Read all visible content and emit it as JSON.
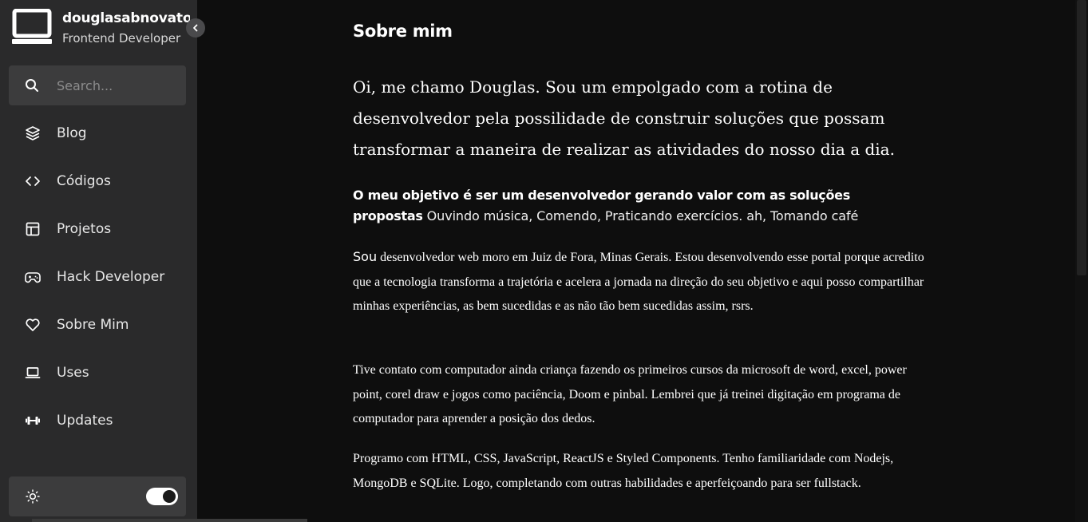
{
  "profile": {
    "name": "douglasabnovato",
    "role": "Frontend Developer",
    "icon": "laptop-icon"
  },
  "search": {
    "placeholder": "Search..."
  },
  "nav": {
    "items": [
      {
        "label": "Blog",
        "icon": "layers-icon"
      },
      {
        "label": "Códigos",
        "icon": "code-icon"
      },
      {
        "label": "Projetos",
        "icon": "layout-icon"
      },
      {
        "label": "Hack Developer",
        "icon": "gamepad-icon"
      },
      {
        "label": "Sobre Mim",
        "icon": "heart-icon"
      },
      {
        "label": "Uses",
        "icon": "laptop-icon"
      },
      {
        "label": "Updates",
        "icon": "dumbbell-icon"
      }
    ]
  },
  "theme": {
    "icon": "sun-icon",
    "dark_mode_enabled": true
  },
  "article": {
    "title": "Sobre mim",
    "intro": "Oi, me chamo Douglas. Sou um empolgado com a rotina de desenvolvedor pela possilidade de construir soluções que possam transformar a maneira de realizar as atividades do nosso dia a dia.",
    "goal_bold": "O meu objetivo é ser um desenvolvedor gerando valor com as soluções propostas",
    "goal_hobbies": "Ouvindo música, Comendo, Praticando exercícios. ah, Tomando café",
    "p1_lead": "Sou",
    "p1_rest": " desenvolvedor web moro em Juiz de Fora, Minas Gerais. Estou desenvolvendo esse portal porque acredito que a tecnologia transforma a trajetória e acelera a jornada na direção do seu objetivo e aqui posso compartilhar minhas experiências, as bem sucedidas e as não tão bem sucedidas assim, rsrs.",
    "p2": "Tive contato com computador ainda criança fazendo os primeiros cursos da microsoft de word, excel, power point, corel draw e jogos como paciência, Doom e pinbal. Lembrei que já treinei digitação em programa de computador para aprender a posição dos dedos.",
    "p3": "Programo com HTML, CSS, JavaScript, ReactJS e Styled Components. Tenho familiaridade com Nodejs, MongoDB e SQLite. Logo, completando com outras habilidades e aperfeiçoando para ser fullstack."
  },
  "colors": {
    "sidebar_bg": "#2a2a2b",
    "main_bg": "#0e0e0e",
    "input_bg": "#3c3c3d",
    "text": "#ffffff"
  }
}
